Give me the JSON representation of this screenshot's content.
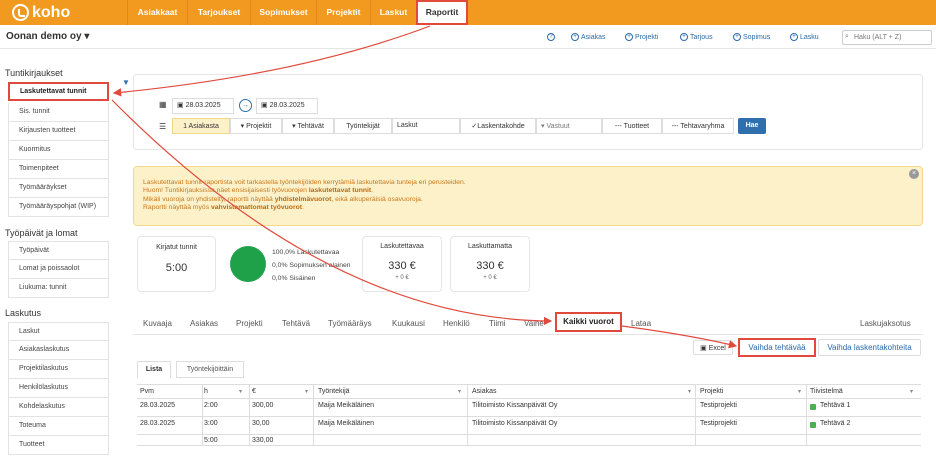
{
  "brand": {
    "name": "koho"
  },
  "nav": [
    "Asiakkaat",
    "Tarjoukset",
    "Sopimukset",
    "Projektit",
    "Laskut",
    "Raportit"
  ],
  "company": "Oonan demo oy",
  "quick": [
    "Asiakas",
    "Projekti",
    "Tarjous",
    "Sopimus",
    "Lasku"
  ],
  "search": {
    "placeholder": "Haku (ALT + Z)"
  },
  "sidebar": {
    "s1": "Tuntikirjaukset",
    "items1": [
      "Laskutettavat tunnit",
      "Sis. tunnit",
      "Kirjausten tuotteet",
      "Kuormitus",
      "Toimenpiteet",
      "Työmääräykset",
      "Työmääräyspohjat (WIP)"
    ],
    "s2": "Työpäivät ja lomat",
    "items2": [
      "Työpäivät",
      "Lomat ja poissaolot",
      "Liukuma: tunnit"
    ],
    "s3": "Laskutus",
    "items3": [
      "Laskut",
      "Asiakaslaskutus",
      "Projektilaskutus",
      "Henkilölaskutus",
      "Kohdelaskutus",
      "Toteuma",
      "Tuotteet"
    ]
  },
  "filters": {
    "date_from": "28.03.2025",
    "date_to": "28.03.2025",
    "row": [
      "1 Asiakasta",
      "Projektit",
      "Tehtävät",
      "Työntekijät",
      "Laskut",
      "Laskentakohde",
      "Vastuut",
      "--- Tuotteet",
      "--- Tehtavaryhma"
    ],
    "hae": "Hae"
  },
  "info": {
    "l1": "Laskutettavat tunnit-raportista voit tarkastella työntekijöiden kerrytämiä laskutettavia tunteja eri perusteiden.",
    "l2a": "Huom! Tuntikirjauksissa näet ensisijaisesti työvuorojen ",
    "l2b": "laskutettavat tunnit",
    "l3a": "Mikäli vuoroja on yhdistelty, raportti näyttää ",
    "l3b": "yhdistelmävuorot",
    ", eikä alkuperäisiä osavuoroja.": "",
    "l3c": ", eikä alkuperäisiä osavuoroja.",
    "l4a": "Raportti näyttää myös ",
    "l4b": "vahvistamattomat työvuorot"
  },
  "stats": {
    "kirjatut_label": "Kirjatut tunnit",
    "kirjatut_value": "5:00",
    "p1": "100,0% Laskutettavaa",
    "p2": "0,0% Sopimuksen alainen",
    "p3": "0,0% Sisäinen",
    "lask_label": "Laskutettavaa",
    "lask_value": "330 €",
    "lask_sub": "+ 0 €",
    "lmat_label": "Laskuttamatta",
    "lmat_value": "330 €",
    "lmat_sub": "+ 0 €",
    "pie_color": "#1fa14a"
  },
  "tabs": [
    "Kuvaaja",
    "Asiakas",
    "Projekti",
    "Tehtävä",
    "Työmääräys",
    "Kuukausi",
    "Henkilö",
    "Tiimi",
    "Vaihe",
    "Kaikki vuorot",
    "Lataa",
    "Laskujaksotus"
  ],
  "buttons": {
    "excel": "Excel",
    "vaihda_tehtava": "Vaihda tehtävää",
    "vaihda_kohde": "Vaihda laskentakohteita"
  },
  "subtabs": [
    "Lista",
    "Työntekijöittäin"
  ],
  "table": {
    "headers": [
      "Pvm",
      "h",
      "€",
      "Työntekijä",
      "Asiakas",
      "Projekti",
      "Tiivistelmä"
    ],
    "rows": [
      [
        "28.03.2025",
        "2:00",
        "300,00",
        "Maija Meikäläinen",
        "Tilitoimisto Kissanpäivät Oy",
        "Testiprojekti",
        "Tehtävä 1"
      ],
      [
        "28.03.2025",
        "3:00",
        "30,00",
        "Maija Meikäläinen",
        "Tilitoimisto Kissanpäivät Oy",
        "Testiprojekti",
        "Tehtävä 2"
      ]
    ],
    "total_h": "5:00",
    "total_eur": "330,00"
  }
}
